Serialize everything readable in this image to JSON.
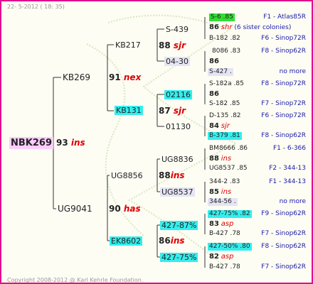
{
  "header": {
    "date_text": "22- 5-2012 ( 18: 35)"
  },
  "footer": {
    "copyright": "Copyright 2008-2012 @ Karl Kehrle Foundation."
  },
  "root": {
    "label": "NBK269",
    "number": "93",
    "suffix": "ins"
  },
  "gen1": [
    {
      "label": "KB269",
      "number": "91",
      "suffix": "nex"
    },
    {
      "label": "UG9041",
      "number": "90",
      "suffix": "has"
    }
  ],
  "gen2": [
    {
      "label": "KB217",
      "number": "88",
      "suffix": "sjr"
    },
    {
      "label": "KB131",
      "number": "87",
      "suffix": "sjr"
    },
    {
      "label": "UG8856",
      "number": "88",
      "suffix": "ins"
    },
    {
      "label": "EK8602",
      "number": "86",
      "suffix": "ins"
    }
  ],
  "gen3": [
    "S-439",
    "04-30",
    "02116",
    "01130",
    "UG8836",
    "UG8537",
    "427-87%",
    "427-75%"
  ],
  "gen4": [
    {
      "top": "S-6 .85",
      "mid_num": "86",
      "mid_suf": "shr",
      "mid_note": "(6 sister colonies)",
      "bot": "B-182 .82"
    },
    {
      "top": "8086 .83",
      "mid_num": "86",
      "mid_suf": "",
      "mid_note": "",
      "bot": "S-427 ."
    },
    {
      "top": "S-182a .85",
      "mid_num": "86",
      "mid_suf": "",
      "mid_note": "",
      "bot": "S-182 .85"
    },
    {
      "top": "D-135 .82",
      "mid_num": "84",
      "mid_suf": "sjr",
      "mid_note": "",
      "bot": "B-379 .81"
    },
    {
      "top": "BM8666 .86",
      "mid_num": "88",
      "mid_suf": "ins",
      "mid_note": "",
      "bot": "UG8537 .85"
    },
    {
      "top": "344-2 .83",
      "mid_num": "85",
      "mid_suf": "ins",
      "mid_note": "",
      "bot": "344-56 ."
    },
    {
      "top": "427-75% .82",
      "mid_num": "83",
      "mid_suf": "asp",
      "mid_note": "",
      "bot": "B-427 .78"
    },
    {
      "top": "427-50% .80",
      "mid_num": "82",
      "mid_suf": "asp",
      "mid_note": "",
      "bot": "B-427 .78"
    }
  ],
  "right_labels": [
    "F1 - Atlas85R",
    "F6 - Sinop72R",
    "F8 - Sinop62R",
    "no more",
    "F8 - Sinop72R",
    "F7 - Sinop72R",
    "F6 - Sinop72R",
    "F8 - Sinop62R",
    "F1 - 6-366",
    "F2 - 344-13",
    "F1 - 344-13",
    "no more",
    "F9 - Sinop62R",
    "F7 - Sinop62R",
    "F8 - Sinop62R",
    "F7 - Sinop62R"
  ],
  "colors": {
    "frame": "#e0108c",
    "root_bg": "#ffccff",
    "highlight_cyan": "#33eeee",
    "highlight_green": "#33dd33",
    "right_label": "#1a1aa8",
    "suffix": "#dd0000"
  }
}
